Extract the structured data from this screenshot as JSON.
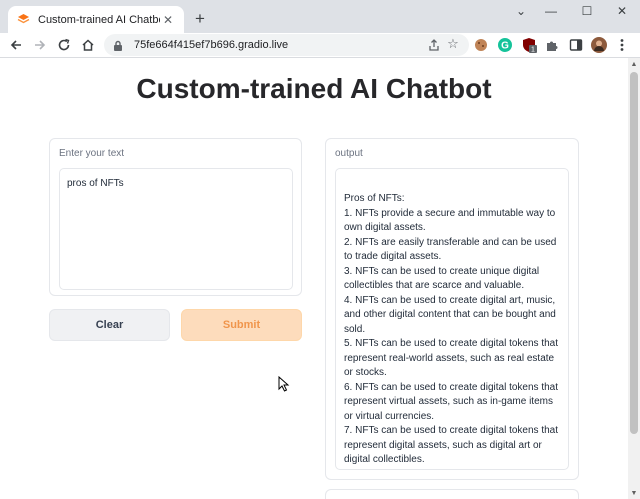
{
  "browser": {
    "tab_title": "Custom-trained AI Chatbot",
    "new_tab": "+",
    "url": "75fe664f415ef7b696.gradio.live",
    "window_controls": {
      "minimize": "—",
      "maximize": "☐",
      "close": "✕",
      "tab_search": "⌄"
    },
    "extension_badge": "1"
  },
  "app": {
    "title": "Custom-trained AI Chatbot",
    "input": {
      "label": "Enter your text",
      "value": "pros of NFTs"
    },
    "buttons": {
      "clear": "Clear",
      "submit": "Submit"
    },
    "output": {
      "label": "output",
      "text": "Pros of NFTs:\n1. NFTs provide a secure and immutable way to own digital assets.\n2. NFTs are easily transferable and can be used to trade digital assets.\n3. NFTs can be used to create unique digital collectibles that are scarce and valuable.\n4. NFTs can be used to create digital art, music, and other digital content that can be bought and sold.\n5. NFTs can be used to create digital tokens that represent real-world assets, such as real estate or stocks.\n6. NFTs can be used to create digital tokens that represent virtual assets, such as in-game items or virtual currencies.\n7. NFTs can be used to create digital tokens that represent digital assets, such as digital art or digital collectibles."
    }
  },
  "colors": {
    "accent": "#f97316",
    "submit_bg": "#fddcbc"
  }
}
